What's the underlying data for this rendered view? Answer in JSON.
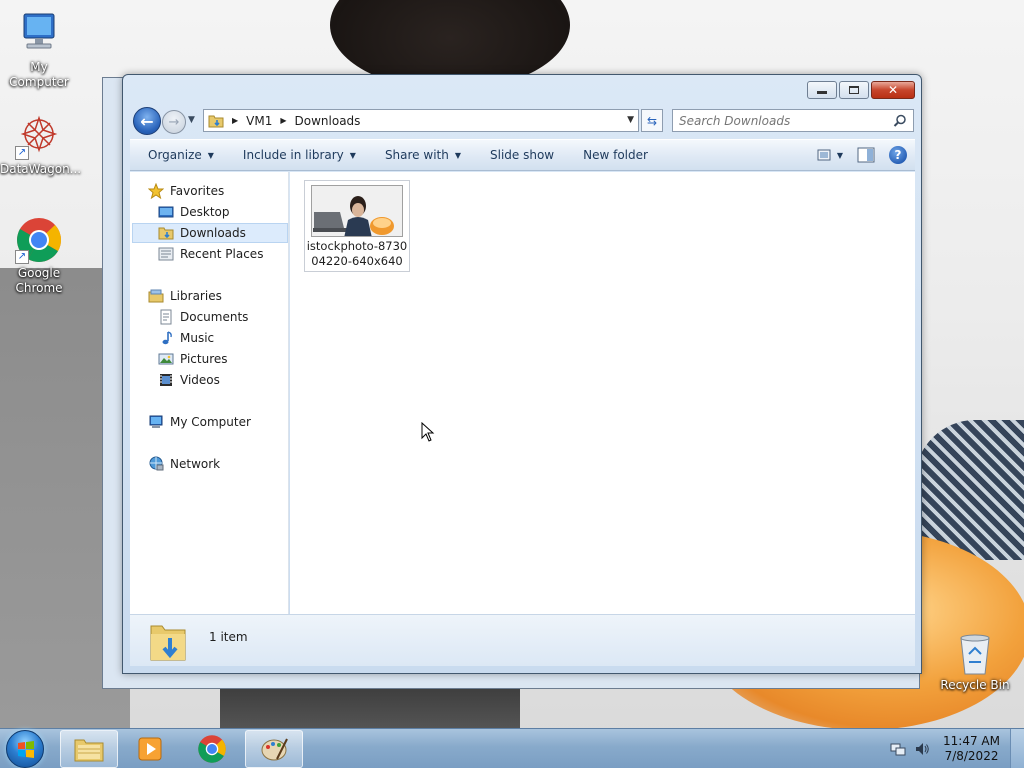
{
  "desktop": {
    "icons": [
      {
        "label": "My Computer"
      },
      {
        "label": "DataWagon..."
      },
      {
        "label": "Google Chrome"
      },
      {
        "label": "Recycle Bin"
      }
    ]
  },
  "window": {
    "caption": {
      "minimize": "minimize-icon",
      "maximize": "maximize-icon",
      "close": "close-icon"
    },
    "address": {
      "crumbs": [
        "VM1",
        "Downloads"
      ]
    },
    "search": {
      "placeholder": "Search Downloads"
    },
    "toolbar": {
      "organize": "Organize",
      "include_in_library": "Include in library",
      "share_with": "Share with",
      "slide_show": "Slide show",
      "new_folder": "New folder"
    },
    "nav": {
      "favorites": "Favorites",
      "desktop": "Desktop",
      "downloads": "Downloads",
      "recent_places": "Recent Places",
      "libraries": "Libraries",
      "documents": "Documents",
      "music": "Music",
      "pictures": "Pictures",
      "videos": "Videos",
      "my_computer": "My Computer",
      "network": "Network"
    },
    "files": [
      {
        "line1": "istockphoto-8730",
        "line2": "04220-640x640"
      }
    ],
    "details": {
      "count": "1 item"
    }
  },
  "taskbar": {
    "time": "11:47 AM",
    "date": "7/8/2022"
  },
  "colors": {
    "window_frame": "#c9dbef",
    "selection": "#dcebfc",
    "taskbar": "#88aacb",
    "close_button": "#c7462c"
  }
}
